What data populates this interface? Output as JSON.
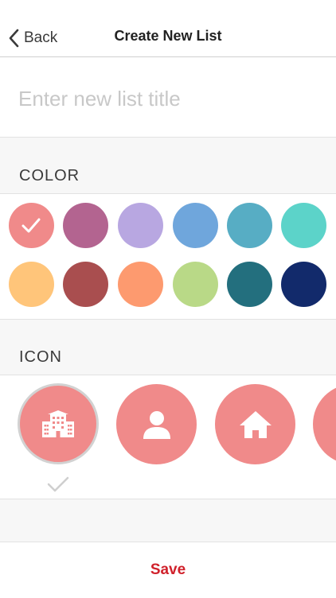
{
  "nav": {
    "back_label": "Back",
    "title": "Create New List"
  },
  "title_input": {
    "placeholder": "Enter new list title",
    "value": ""
  },
  "color_section": {
    "label": "COLOR"
  },
  "colors": [
    "#f08a8a",
    "#b36490",
    "#b8a7e1",
    "#6fa6dc",
    "#57adc4",
    "#5cd3c9",
    "#ffc57a",
    "#a94e4f",
    "#fd9a6f",
    "#b9d987",
    "#236f7e",
    "#122a6b"
  ],
  "selected_color": "#f08a8a",
  "icon_section": {
    "label": "ICON"
  },
  "icons": [
    "building-icon",
    "person-icon",
    "home-icon",
    "partial-icon"
  ],
  "selected_icon": "building-icon",
  "footer": {
    "save_label": "Save",
    "save_color": "#d0212b"
  }
}
